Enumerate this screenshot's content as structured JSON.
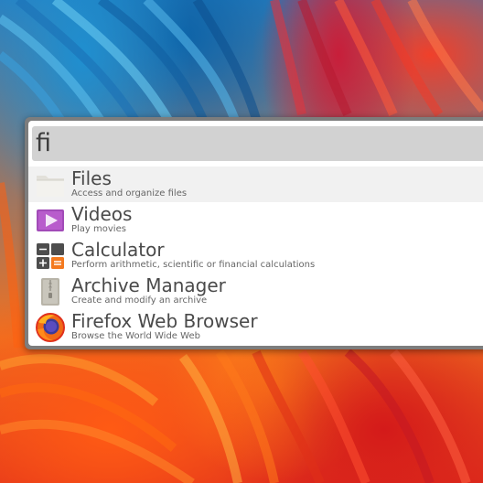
{
  "colors": {
    "launcher_border": "#7d7d7d",
    "search_background": "#d2d2d2",
    "selected_background": "#f1f1f1",
    "title_text": "#4a4a4a",
    "description_text": "#666666"
  },
  "search": {
    "value": "fi"
  },
  "results": [
    {
      "name": "Files",
      "description": "Access and organize files",
      "icon": "folder-icon",
      "selected": true
    },
    {
      "name": "Videos",
      "description": "Play movies",
      "icon": "videos-play-icon",
      "selected": false
    },
    {
      "name": "Calculator",
      "description": "Perform arithmetic, scientific or financial calculations",
      "icon": "calculator-icon",
      "selected": false
    },
    {
      "name": "Archive Manager",
      "description": "Create and modify an archive",
      "icon": "archive-zipper-icon",
      "selected": false
    },
    {
      "name": "Firefox Web Browser",
      "description": "Browse the World Wide Web",
      "icon": "firefox-icon",
      "selected": false
    }
  ]
}
